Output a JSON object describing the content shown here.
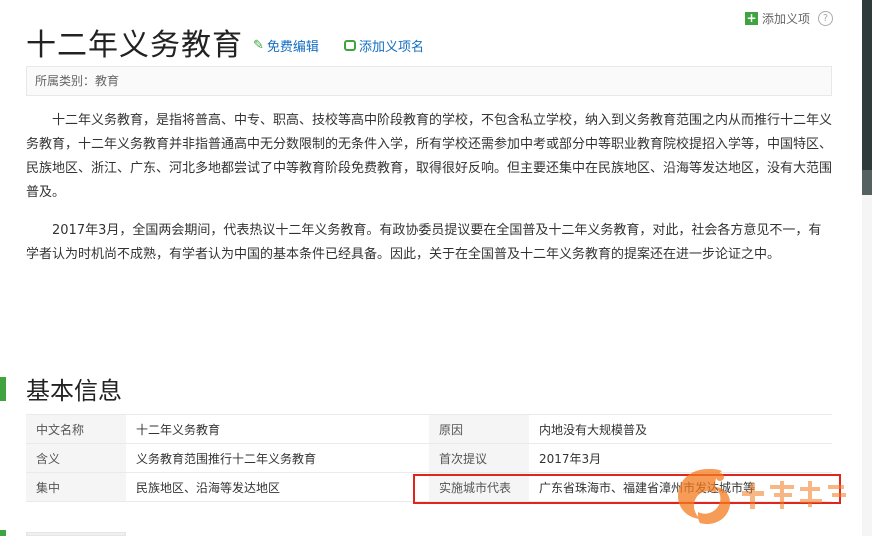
{
  "page": {
    "title": "十二年义务教育",
    "edit_label": "免费编辑",
    "add_name_label": "添加义项名",
    "add_item_label": "添加义项",
    "help_icon": "question-icon",
    "category": "所属类别：教育"
  },
  "paragraphs": [
    "十二年义务教育，是指将普高、中专、职高、技校等高中阶段教育的学校，不包含私立学校，纳入到义务教育范围之内从而推行十二年义务教育，十二年义务教育并非指普通高中无分数限制的无条件入学，所有学校还需参加中考或部分中等职业教育院校提招入学等，中国特区、民族地区、浙江、广东、河北多地都尝试了中等教育阶段免费教育，取得很好反响。但主要还集中在民族地区、沿海等发达地区，没有大范围普及。",
    "2017年3月，全国两会期间，代表热议十二年义务教育。有政协委员提议要在全国普及十二年义务教育，对此，社会各方意见不一，有学者认为时机尚不成熟，有学者认为中国的基本条件已经具备。因此，关于在全国普及十二年义务教育的提案还在进一步论证之中。"
  ],
  "basic_info": {
    "heading": "基本信息",
    "rows": [
      [
        {
          "k": "中文名称",
          "v": "十二年义务教育"
        },
        {
          "k": "原因",
          "v": "内地没有大规模普及"
        }
      ],
      [
        {
          "k": "含义",
          "v": "义务教育范围推行十二年义务教育"
        },
        {
          "k": "首次提议",
          "v": "2017年3月"
        }
      ],
      [
        {
          "k": "集中",
          "v": "民族地区、沿海等发达地区"
        },
        {
          "k": "实施城市代表",
          "v": "广东省珠海市、福建省漳州市发达城市等"
        }
      ]
    ]
  },
  "colors": {
    "accent_green": "#3fa33f",
    "link_blue": "#136ec2",
    "highlight_red": "#e0251d",
    "watermark_orange": "#f47b20"
  }
}
